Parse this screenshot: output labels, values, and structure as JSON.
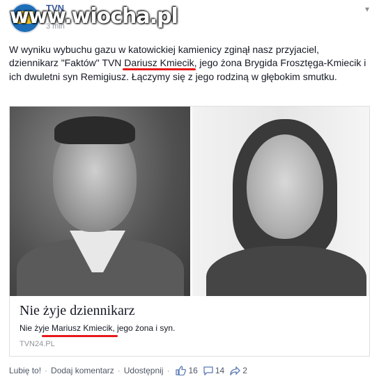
{
  "header": {
    "page_name": "TVN",
    "time": "3 min",
    "watermark": "www.wiocha.pl"
  },
  "post": {
    "text_1": "W wyniku wybuchu gazu w katowickiej kamienicy zginął nasz przyjaciel, dziennikarz \"Faktów\" TVN ",
    "name_highlight": "Dariusz Kmiecik",
    "text_2": ", jego żona Brygida Frosztęga-Kmiecik i ich dwuletni syn Remigiusz. Łączymy się z jego rodziną w głębokim smutku."
  },
  "card": {
    "title": "Nie żyje dziennikarz",
    "desc_1": "Nie żyje ",
    "desc_name": "Mariusz Kmiecik",
    "desc_2": ", jego żona i syn.",
    "source": "TVN24.PL"
  },
  "actions": {
    "like": "Lubię to!",
    "comment": "Dodaj komentarz",
    "share": "Udostępnij",
    "likes_count": "16",
    "comments_count": "14",
    "shares_count": "2"
  },
  "colors": {
    "link": "#3b5998",
    "highlight": "#e81818"
  }
}
